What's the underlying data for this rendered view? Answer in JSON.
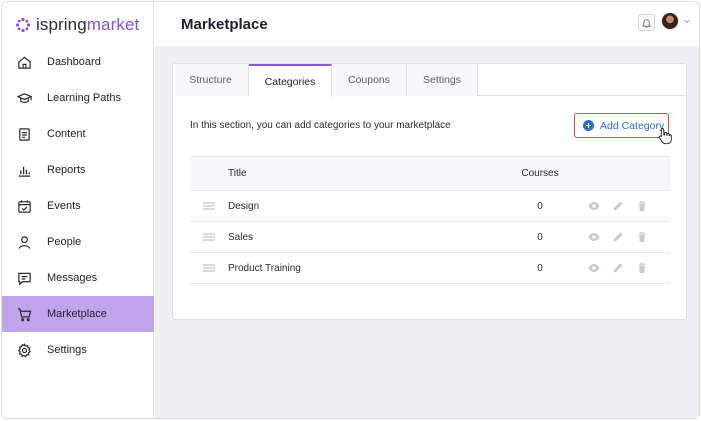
{
  "brand": {
    "name_part1": "ispring",
    "name_part2": "market",
    "accent": "#8b4fd8"
  },
  "sidebar": {
    "items": [
      {
        "label": "Dashboard",
        "icon": "home-icon"
      },
      {
        "label": "Learning Paths",
        "icon": "graduation-cap-icon"
      },
      {
        "label": "Content",
        "icon": "document-icon"
      },
      {
        "label": "Reports",
        "icon": "bar-chart-icon"
      },
      {
        "label": "Events",
        "icon": "calendar-check-icon"
      },
      {
        "label": "People",
        "icon": "person-icon"
      },
      {
        "label": "Messages",
        "icon": "message-icon"
      },
      {
        "label": "Marketplace",
        "icon": "cart-icon",
        "active": true
      },
      {
        "label": "Settings",
        "icon": "gear-icon"
      }
    ],
    "active_color": "#c2a4ec"
  },
  "header": {
    "title": "Marketplace"
  },
  "tabs": [
    {
      "label": "Structure"
    },
    {
      "label": "Categories",
      "active": true
    },
    {
      "label": "Coupons"
    },
    {
      "label": "Settings"
    }
  ],
  "section": {
    "intro": "In this section, you can add categories to your marketplace",
    "add_button": "Add Category"
  },
  "table": {
    "columns": {
      "title": "Title",
      "courses": "Courses"
    },
    "rows": [
      {
        "title": "Design",
        "courses": "0"
      },
      {
        "title": "Sales",
        "courses": "0"
      },
      {
        "title": "Product Training",
        "courses": "0"
      }
    ]
  }
}
